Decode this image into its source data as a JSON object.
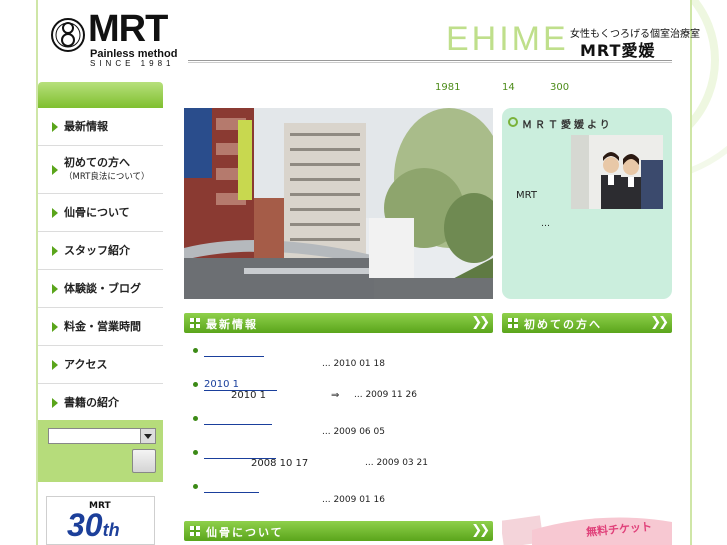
{
  "header": {
    "logo_main": "MRT",
    "logo_sub": "Painless method",
    "logo_since": "SINCE 1981",
    "region": "EHIME",
    "tagline": "女性もくつろげる個室治療室",
    "clinic_name": "MRT愛媛"
  },
  "stats": [
    "1981",
    "14",
    "300"
  ],
  "nav": {
    "items": [
      {
        "label": "最新情報"
      },
      {
        "label": "初めての方へ",
        "sub": "（MRT良法について）"
      },
      {
        "label": "仙骨について"
      },
      {
        "label": "スタッフ紹介"
      },
      {
        "label": "体験談・ブログ"
      },
      {
        "label": "料金・営業時間"
      },
      {
        "label": "アクセス"
      },
      {
        "label": "書籍の紹介"
      }
    ]
  },
  "greeting": {
    "title": "ＭＲＴ愛媛より",
    "text1": "MRT",
    "text2": "…"
  },
  "sections": {
    "news_title": "最新情報",
    "first_time_title": "初めての方へ",
    "sacrum_title": "仙骨について"
  },
  "news": [
    {
      "link": "",
      "date": "... 2010 01 18"
    },
    {
      "link": "2010 1",
      "sub": "2010 1",
      "arrow": "⇒",
      "date": "... 2009 11 26"
    },
    {
      "link": "",
      "date": "... 2009 06 05"
    },
    {
      "link": "",
      "sub": "2008 10 17",
      "date": "... 2009 03 21"
    },
    {
      "link": "",
      "date": "... 2009 01 16"
    }
  ],
  "banner": {
    "mrt": "MRT",
    "num": "30",
    "suffix": "th"
  },
  "ticket": {
    "text": "無料チケット"
  },
  "colors": {
    "accent_green": "#5aa51b",
    "light_green": "#b6dc7b",
    "greeting_bg": "#cbeedd",
    "link": "#1a3f9c"
  }
}
